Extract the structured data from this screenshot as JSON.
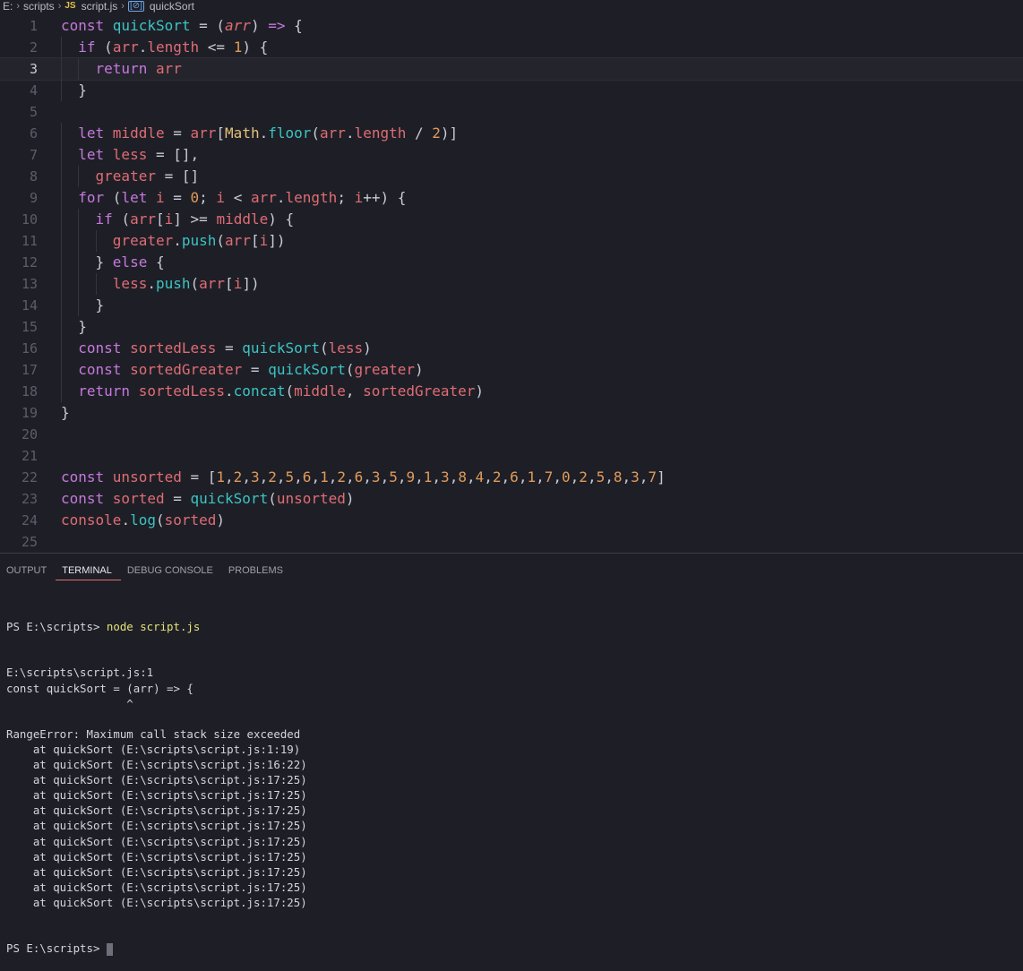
{
  "breadcrumb": {
    "drive": "E:",
    "folder": "scripts",
    "file_icon": "JS",
    "file": "script.js",
    "symbol_icon": "[⊘]",
    "symbol": "quickSort"
  },
  "editor": {
    "current_line": 3,
    "lines": [
      {
        "n": "1",
        "t": [
          [
            "kw",
            "const "
          ],
          [
            "fn",
            "quickSort"
          ],
          [
            "op",
            " = ("
          ],
          [
            "pa",
            "arr"
          ],
          [
            "op",
            ") "
          ],
          [
            "kw",
            "=>"
          ],
          [
            "op",
            " {"
          ]
        ]
      },
      {
        "n": "2",
        "t": [
          [
            "kw",
            "  if "
          ],
          [
            "op",
            "("
          ],
          [
            "vr",
            "arr"
          ],
          [
            "op",
            "."
          ],
          [
            "vr",
            "length"
          ],
          [
            "op",
            " <= "
          ],
          [
            "nm",
            "1"
          ],
          [
            "op",
            ") {"
          ]
        ]
      },
      {
        "n": "3",
        "t": [
          [
            "kw",
            "    return "
          ],
          [
            "vr",
            "arr"
          ]
        ]
      },
      {
        "n": "4",
        "t": [
          [
            "op",
            "  }"
          ]
        ]
      },
      {
        "n": "5",
        "t": []
      },
      {
        "n": "6",
        "t": [
          [
            "kw",
            "  let "
          ],
          [
            "vr",
            "middle"
          ],
          [
            "op",
            " = "
          ],
          [
            "vr",
            "arr"
          ],
          [
            "op",
            "["
          ],
          [
            "ob",
            "Math"
          ],
          [
            "op",
            "."
          ],
          [
            "fn",
            "floor"
          ],
          [
            "op",
            "("
          ],
          [
            "vr",
            "arr"
          ],
          [
            "op",
            "."
          ],
          [
            "vr",
            "length"
          ],
          [
            "op",
            " / "
          ],
          [
            "nm",
            "2"
          ],
          [
            "op",
            ")]"
          ]
        ]
      },
      {
        "n": "7",
        "t": [
          [
            "kw",
            "  let "
          ],
          [
            "vr",
            "less"
          ],
          [
            "op",
            " = [],"
          ]
        ]
      },
      {
        "n": "8",
        "t": [
          [
            "vr",
            "    greater"
          ],
          [
            "op",
            " = []"
          ]
        ]
      },
      {
        "n": "9",
        "t": [
          [
            "kw",
            "  for "
          ],
          [
            "op",
            "("
          ],
          [
            "kw",
            "let "
          ],
          [
            "vr",
            "i"
          ],
          [
            "op",
            " = "
          ],
          [
            "nm",
            "0"
          ],
          [
            "op",
            "; "
          ],
          [
            "vr",
            "i"
          ],
          [
            "op",
            " < "
          ],
          [
            "vr",
            "arr"
          ],
          [
            "op",
            "."
          ],
          [
            "vr",
            "length"
          ],
          [
            "op",
            "; "
          ],
          [
            "vr",
            "i"
          ],
          [
            "op",
            "++) {"
          ]
        ]
      },
      {
        "n": "10",
        "t": [
          [
            "kw",
            "    if "
          ],
          [
            "op",
            "("
          ],
          [
            "vr",
            "arr"
          ],
          [
            "op",
            "["
          ],
          [
            "vr",
            "i"
          ],
          [
            "op",
            "] >= "
          ],
          [
            "vr",
            "middle"
          ],
          [
            "op",
            ") {"
          ]
        ]
      },
      {
        "n": "11",
        "t": [
          [
            "vr",
            "      greater"
          ],
          [
            "op",
            "."
          ],
          [
            "fn",
            "push"
          ],
          [
            "op",
            "("
          ],
          [
            "vr",
            "arr"
          ],
          [
            "op",
            "["
          ],
          [
            "vr",
            "i"
          ],
          [
            "op",
            "])"
          ]
        ]
      },
      {
        "n": "12",
        "t": [
          [
            "op",
            "    } "
          ],
          [
            "kw",
            "else"
          ],
          [
            "op",
            " {"
          ]
        ]
      },
      {
        "n": "13",
        "t": [
          [
            "vr",
            "      less"
          ],
          [
            "op",
            "."
          ],
          [
            "fn",
            "push"
          ],
          [
            "op",
            "("
          ],
          [
            "vr",
            "arr"
          ],
          [
            "op",
            "["
          ],
          [
            "vr",
            "i"
          ],
          [
            "op",
            "])"
          ]
        ]
      },
      {
        "n": "14",
        "t": [
          [
            "op",
            "    }"
          ]
        ]
      },
      {
        "n": "15",
        "t": [
          [
            "op",
            "  }"
          ]
        ]
      },
      {
        "n": "16",
        "t": [
          [
            "kw",
            "  const "
          ],
          [
            "vr",
            "sortedLess"
          ],
          [
            "op",
            " = "
          ],
          [
            "fn",
            "quickSort"
          ],
          [
            "op",
            "("
          ],
          [
            "vr",
            "less"
          ],
          [
            "op",
            ")"
          ]
        ]
      },
      {
        "n": "17",
        "t": [
          [
            "kw",
            "  const "
          ],
          [
            "vr",
            "sortedGreater"
          ],
          [
            "op",
            " = "
          ],
          [
            "fn",
            "quickSort"
          ],
          [
            "op",
            "("
          ],
          [
            "vr",
            "greater"
          ],
          [
            "op",
            ")"
          ]
        ]
      },
      {
        "n": "18",
        "t": [
          [
            "kw",
            "  return "
          ],
          [
            "vr",
            "sortedLess"
          ],
          [
            "op",
            "."
          ],
          [
            "fn",
            "concat"
          ],
          [
            "op",
            "("
          ],
          [
            "vr",
            "middle"
          ],
          [
            "op",
            ", "
          ],
          [
            "vr",
            "sortedGreater"
          ],
          [
            "op",
            ")"
          ]
        ]
      },
      {
        "n": "19",
        "t": [
          [
            "op",
            "}"
          ]
        ]
      },
      {
        "n": "20",
        "t": []
      },
      {
        "n": "21",
        "t": []
      },
      {
        "n": "22",
        "t": [
          [
            "kw",
            "const "
          ],
          [
            "vr",
            "unsorted"
          ],
          [
            "op",
            " = ["
          ],
          [
            "nm",
            "1"
          ],
          [
            "op",
            ","
          ],
          [
            "nm",
            "2"
          ],
          [
            "op",
            ","
          ],
          [
            "nm",
            "3"
          ],
          [
            "op",
            ","
          ],
          [
            "nm",
            "2"
          ],
          [
            "op",
            ","
          ],
          [
            "nm",
            "5"
          ],
          [
            "op",
            ","
          ],
          [
            "nm",
            "6"
          ],
          [
            "op",
            ","
          ],
          [
            "nm",
            "1"
          ],
          [
            "op",
            ","
          ],
          [
            "nm",
            "2"
          ],
          [
            "op",
            ","
          ],
          [
            "nm",
            "6"
          ],
          [
            "op",
            ","
          ],
          [
            "nm",
            "3"
          ],
          [
            "op",
            ","
          ],
          [
            "nm",
            "5"
          ],
          [
            "op",
            ","
          ],
          [
            "nm",
            "9"
          ],
          [
            "op",
            ","
          ],
          [
            "nm",
            "1"
          ],
          [
            "op",
            ","
          ],
          [
            "nm",
            "3"
          ],
          [
            "op",
            ","
          ],
          [
            "nm",
            "8"
          ],
          [
            "op",
            ","
          ],
          [
            "nm",
            "4"
          ],
          [
            "op",
            ","
          ],
          [
            "nm",
            "2"
          ],
          [
            "op",
            ","
          ],
          [
            "nm",
            "6"
          ],
          [
            "op",
            ","
          ],
          [
            "nm",
            "1"
          ],
          [
            "op",
            ","
          ],
          [
            "nm",
            "7"
          ],
          [
            "op",
            ","
          ],
          [
            "nm",
            "0"
          ],
          [
            "op",
            ","
          ],
          [
            "nm",
            "2"
          ],
          [
            "op",
            ","
          ],
          [
            "nm",
            "5"
          ],
          [
            "op",
            ","
          ],
          [
            "nm",
            "8"
          ],
          [
            "op",
            ","
          ],
          [
            "nm",
            "3"
          ],
          [
            "op",
            ","
          ],
          [
            "nm",
            "7"
          ],
          [
            "op",
            "]"
          ]
        ]
      },
      {
        "n": "23",
        "t": [
          [
            "kw",
            "const "
          ],
          [
            "vr",
            "sorted"
          ],
          [
            "op",
            " = "
          ],
          [
            "fn",
            "quickSort"
          ],
          [
            "op",
            "("
          ],
          [
            "vr",
            "unsorted"
          ],
          [
            "op",
            ")"
          ]
        ]
      },
      {
        "n": "24",
        "t": [
          [
            "vr",
            "console"
          ],
          [
            "op",
            "."
          ],
          [
            "fn",
            "log"
          ],
          [
            "op",
            "("
          ],
          [
            "vr",
            "sorted"
          ],
          [
            "op",
            ")"
          ]
        ]
      },
      {
        "n": "25",
        "t": []
      }
    ]
  },
  "panel": {
    "tabs": [
      {
        "label": "OUTPUT",
        "active": false
      },
      {
        "label": "TERMINAL",
        "active": true
      },
      {
        "label": "DEBUG CONSOLE",
        "active": false
      },
      {
        "label": "PROBLEMS",
        "active": false
      }
    ]
  },
  "terminal": {
    "prompt": "PS E:\\scripts> ",
    "command": "node script.js",
    "lines": [
      "E:\\scripts\\script.js:1",
      "const quickSort = (arr) => {",
      "                  ^",
      "",
      "RangeError: Maximum call stack size exceeded",
      "    at quickSort (E:\\scripts\\script.js:1:19)",
      "    at quickSort (E:\\scripts\\script.js:16:22)",
      "    at quickSort (E:\\scripts\\script.js:17:25)",
      "    at quickSort (E:\\scripts\\script.js:17:25)",
      "    at quickSort (E:\\scripts\\script.js:17:25)",
      "    at quickSort (E:\\scripts\\script.js:17:25)",
      "    at quickSort (E:\\scripts\\script.js:17:25)",
      "    at quickSort (E:\\scripts\\script.js:17:25)",
      "    at quickSort (E:\\scripts\\script.js:17:25)",
      "    at quickSort (E:\\scripts\\script.js:17:25)",
      "    at quickSort (E:\\scripts\\script.js:17:25)"
    ],
    "final_prompt": "PS E:\\scripts> "
  }
}
